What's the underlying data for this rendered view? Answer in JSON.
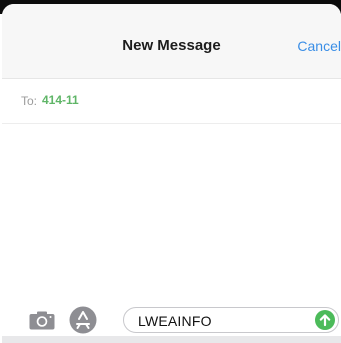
{
  "header": {
    "title": "New Message",
    "cancel_label": "Cancel"
  },
  "recipient": {
    "to_label": "To:",
    "value": "414-11"
  },
  "composer": {
    "camera_icon": "camera-icon",
    "apps_icon": "app-store-icon",
    "message_text": "LWEAINFO",
    "send_icon": "send-arrow-up-icon"
  },
  "colors": {
    "accent_blue": "#3a8ee6",
    "recipient_green": "#5fb567",
    "send_green": "#4cbb5a",
    "header_bg": "#f7f7f7"
  }
}
